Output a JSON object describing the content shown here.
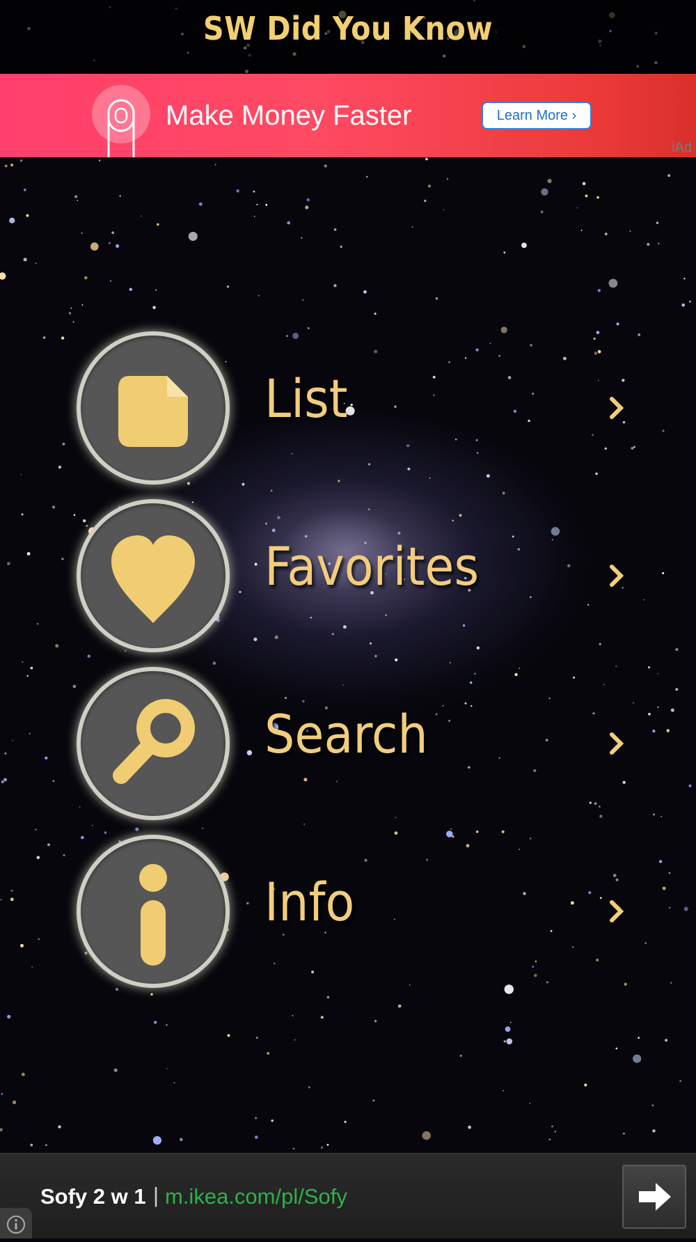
{
  "app": {
    "title": "SW Did You Know"
  },
  "top_ad": {
    "text": "Make Money Faster",
    "button_label": "Learn More",
    "badge": "iAd",
    "colors": {
      "start": "#ff3f6d",
      "end": "#d9302c"
    }
  },
  "menu": {
    "accent_color": "#f2cd7c",
    "items": [
      {
        "label": "List",
        "icon": "document-icon"
      },
      {
        "label": "Favorites",
        "icon": "heart-icon"
      },
      {
        "label": "Search",
        "icon": "magnifier-icon"
      },
      {
        "label": "Info",
        "icon": "info-icon"
      }
    ]
  },
  "bottom_ad": {
    "headline": "Sofy 2 w 1",
    "separator": "|",
    "url": "m.ikea.com/pl/Sofy"
  }
}
